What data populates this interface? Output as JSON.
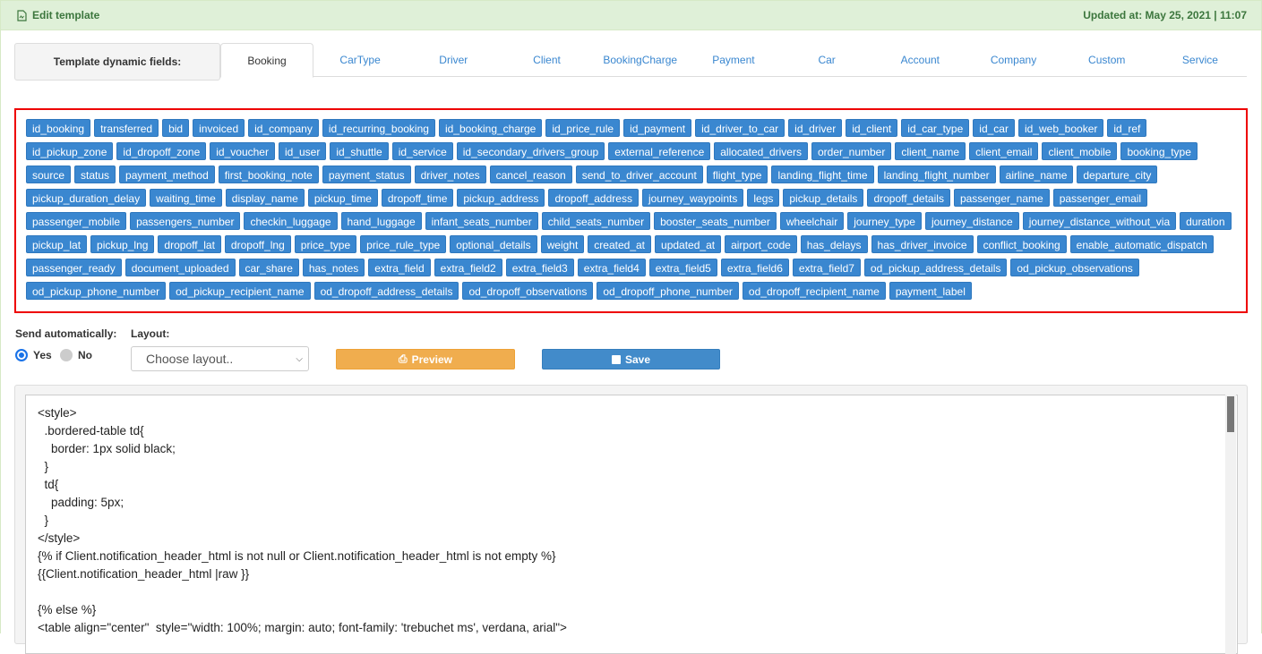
{
  "header": {
    "title": "Edit template",
    "updated": "Updated at: May 25, 2021 | 11:07"
  },
  "tabs": {
    "label": "Template dynamic fields:",
    "items": [
      "Booking",
      "CarType",
      "Driver",
      "Client",
      "BookingCharge",
      "Payment",
      "Car",
      "Account",
      "Company",
      "Custom",
      "Service"
    ],
    "active": "Booking"
  },
  "fields": [
    "id_booking",
    "transferred",
    "bid",
    "invoiced",
    "id_company",
    "id_recurring_booking",
    "id_booking_charge",
    "id_price_rule",
    "id_payment",
    "id_driver_to_car",
    "id_driver",
    "id_client",
    "id_car_type",
    "id_car",
    "id_web_booker",
    "id_ref",
    "id_pickup_zone",
    "id_dropoff_zone",
    "id_voucher",
    "id_user",
    "id_shuttle",
    "id_service",
    "id_secondary_drivers_group",
    "external_reference",
    "allocated_drivers",
    "order_number",
    "client_name",
    "client_email",
    "client_mobile",
    "booking_type",
    "source",
    "status",
    "payment_method",
    "first_booking_note",
    "payment_status",
    "driver_notes",
    "cancel_reason",
    "send_to_driver_account",
    "flight_type",
    "landing_flight_time",
    "landing_flight_number",
    "airline_name",
    "departure_city",
    "pickup_duration_delay",
    "waiting_time",
    "display_name",
    "pickup_time",
    "dropoff_time",
    "pickup_address",
    "dropoff_address",
    "journey_waypoints",
    "legs",
    "pickup_details",
    "dropoff_details",
    "passenger_name",
    "passenger_email",
    "passenger_mobile",
    "passengers_number",
    "checkin_luggage",
    "hand_luggage",
    "infant_seats_number",
    "child_seats_number",
    "booster_seats_number",
    "wheelchair",
    "journey_type",
    "journey_distance",
    "journey_distance_without_via",
    "duration",
    "pickup_lat",
    "pickup_lng",
    "dropoff_lat",
    "dropoff_lng",
    "price_type",
    "price_rule_type",
    "optional_details",
    "weight",
    "created_at",
    "updated_at",
    "airport_code",
    "has_delays",
    "has_driver_invoice",
    "conflict_booking",
    "enable_automatic_dispatch",
    "passenger_ready",
    "document_uploaded",
    "car_share",
    "has_notes",
    "extra_field",
    "extra_field2",
    "extra_field3",
    "extra_field4",
    "extra_field5",
    "extra_field6",
    "extra_field7",
    "od_pickup_address_details",
    "od_pickup_observations",
    "od_pickup_phone_number",
    "od_pickup_recipient_name",
    "od_dropoff_address_details",
    "od_dropoff_observations",
    "od_dropoff_phone_number",
    "od_dropoff_recipient_name",
    "payment_label"
  ],
  "controls": {
    "send_label": "Send automatically:",
    "yes": "Yes",
    "no": "No",
    "send_value": "Yes",
    "layout_label": "Layout:",
    "layout_value": "Choose layout..",
    "preview": "Preview",
    "save": "Save"
  },
  "editor": {
    "content": "<style>\n  .bordered-table td{\n    border: 1px solid black;\n  }\n  td{\n    padding: 5px;\n  }\n</style>\n{% if Client.notification_header_html is not null or Client.notification_header_html is not empty %}\n{{Client.notification_header_html |raw }}\n\n{% else %}\n<table align=\"center\"  style=\"width: 100%; margin: auto; font-family: 'trebuchet ms', verdana, arial\">"
  },
  "colors": {
    "accent": "#3a87d0",
    "header_bg": "#dff0d8",
    "preview": "#f0ad4e",
    "save": "#428bca",
    "highlight_border": "#e00000"
  }
}
